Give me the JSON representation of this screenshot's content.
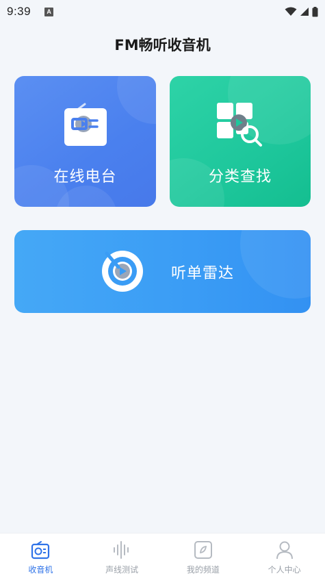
{
  "status_bar": {
    "time": "9:39",
    "notification_badge": "A"
  },
  "page": {
    "title": "FM畅听收音机"
  },
  "cards": {
    "online_radio": {
      "label": "在线电台",
      "icon": "radio-icon"
    },
    "category_search": {
      "label": "分类查找",
      "icon": "grid-search-icon"
    },
    "playlist_radar": {
      "label": "听单雷达",
      "icon": "radar-play-icon"
    }
  },
  "bottom_nav": {
    "items": [
      {
        "label": "收音机",
        "icon": "radio-icon",
        "active": true
      },
      {
        "label": "声线测试",
        "icon": "soundwave-icon",
        "active": false
      },
      {
        "label": "我的频道",
        "icon": "channel-icon",
        "active": false
      },
      {
        "label": "个人中心",
        "icon": "person-icon",
        "active": false
      }
    ]
  },
  "colors": {
    "background": "#f3f6fa",
    "card_blue": "#4a80ee",
    "card_green": "#1ec79c",
    "card_sky": "#3a9cf5",
    "nav_active": "#2f73e8",
    "nav_inactive": "#9aa0a8"
  }
}
